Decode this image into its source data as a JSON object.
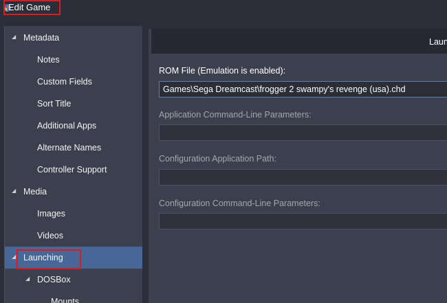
{
  "window": {
    "title": "Edit Game"
  },
  "sidebar": {
    "items": [
      {
        "label": "Metadata",
        "expanded": true
      },
      {
        "label": "Notes"
      },
      {
        "label": "Custom Fields"
      },
      {
        "label": "Sort Title"
      },
      {
        "label": "Additional Apps"
      },
      {
        "label": "Alternate Names"
      },
      {
        "label": "Controller Support"
      },
      {
        "label": "Media",
        "expanded": true
      },
      {
        "label": "Images"
      },
      {
        "label": "Videos"
      },
      {
        "label": "Launching",
        "expanded": true,
        "selected": true
      },
      {
        "label": "DOSBox",
        "expanded": true
      },
      {
        "label": "Mounts"
      }
    ]
  },
  "main": {
    "header": "Launching",
    "fields": [
      {
        "label": "ROM File (Emulation is enabled):",
        "value": "Games\\Sega Dreamcast\\frogger 2 swampy's revenge (usa).chd"
      },
      {
        "label": "Application Command-Line Parameters:",
        "value": ""
      },
      {
        "label": "Configuration Application Path:",
        "value": ""
      },
      {
        "label": "Configuration Command-Line Parameters:",
        "value": ""
      }
    ]
  },
  "colors": {
    "selection": "#476896",
    "annotation": "#e0191f",
    "background": "#2b2d38",
    "panel": "#3c3f4e"
  }
}
